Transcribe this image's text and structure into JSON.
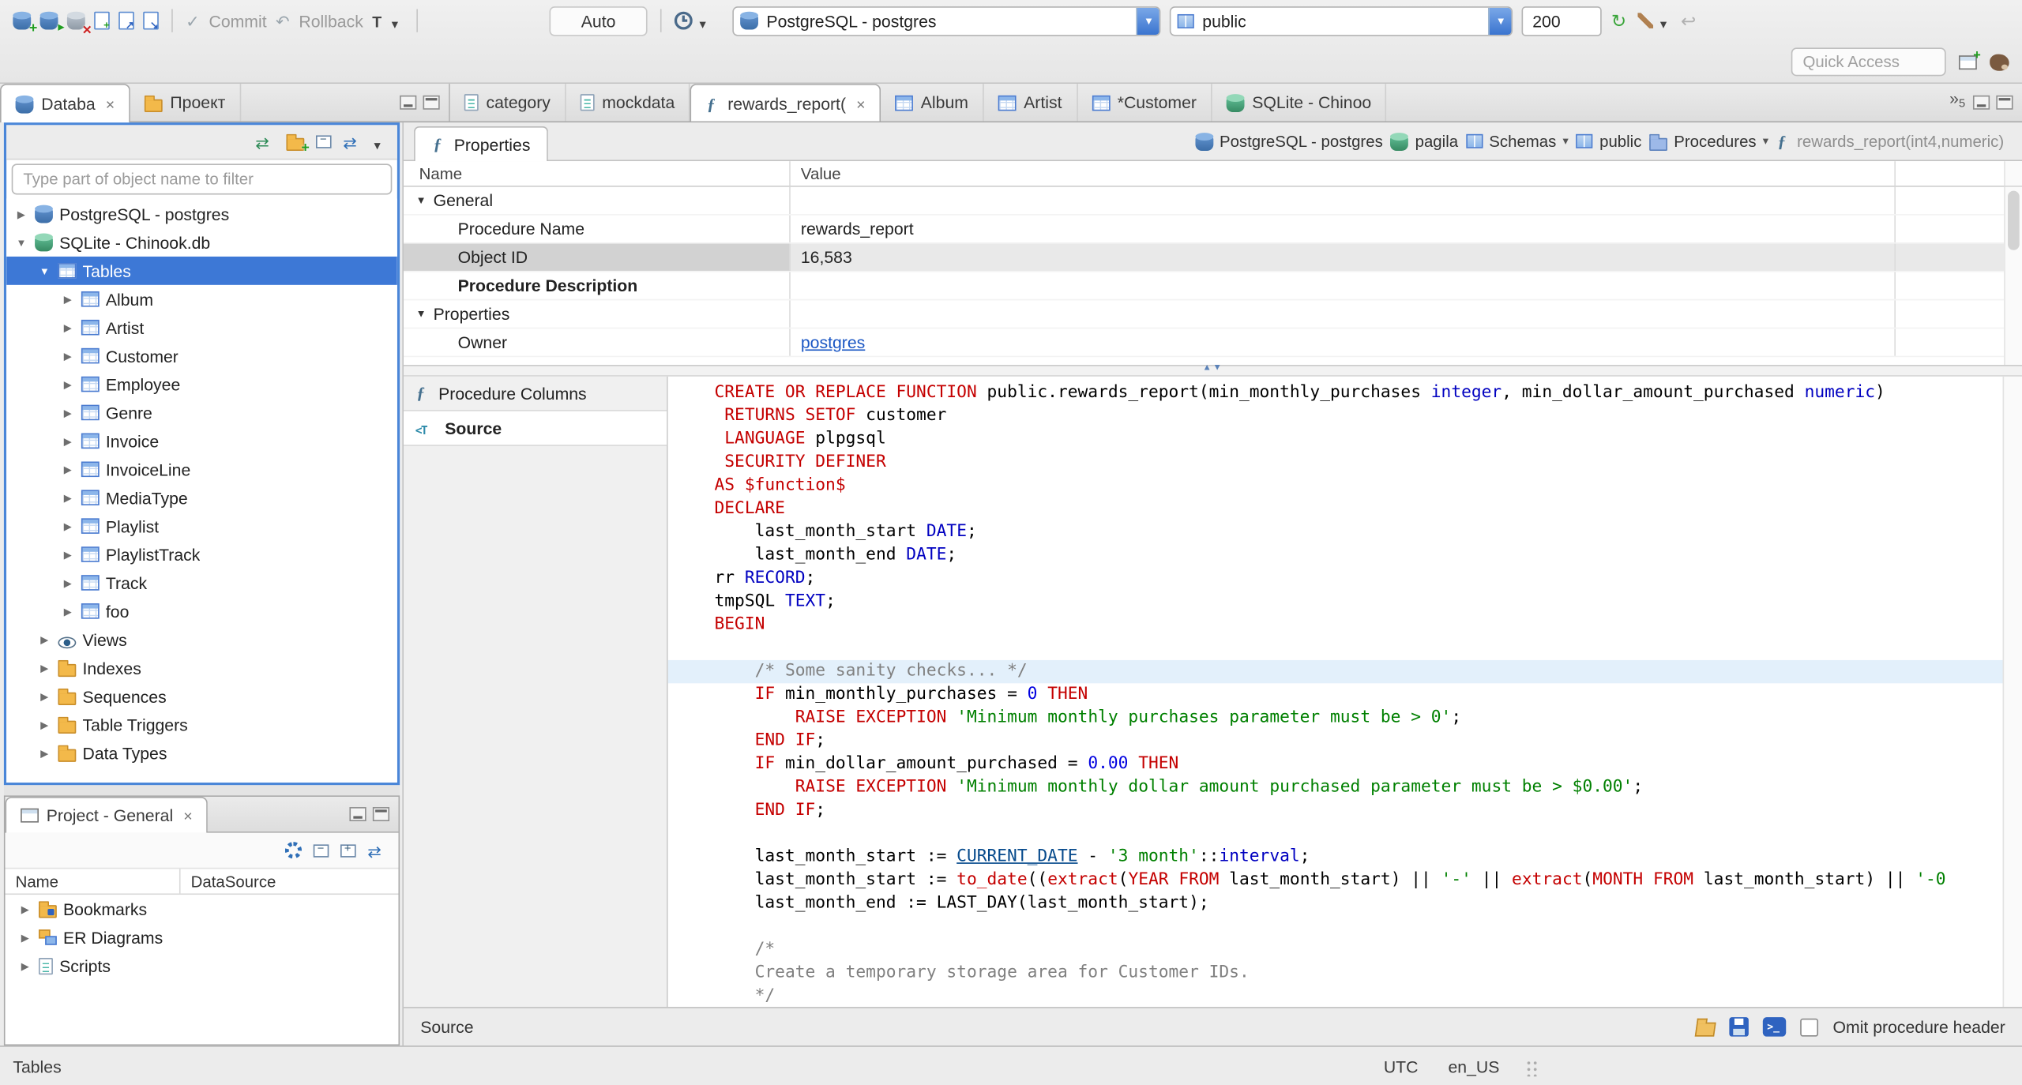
{
  "toolbar": {
    "commit": "Commit",
    "rollback": "Rollback",
    "transaction_mode": "T",
    "auto": "Auto",
    "connection": "PostgreSQL - postgres",
    "schema": "public",
    "fetch_size": "200",
    "quick_access": "Quick Access"
  },
  "left_tab_folder": {
    "tabs": [
      {
        "label": "Databa",
        "icon": "database-navigator",
        "active": true,
        "closable": true
      },
      {
        "label": "Проект",
        "icon": "projects"
      }
    ]
  },
  "editor_tab_folder": {
    "tabs": [
      {
        "label": "category",
        "icon": "sql-script"
      },
      {
        "label": "mockdata",
        "icon": "sql-script"
      },
      {
        "label": "rewards_report(",
        "icon": "function",
        "active": true,
        "closable": true
      },
      {
        "label": "Album",
        "icon": "table"
      },
      {
        "label": "Artist",
        "icon": "table"
      },
      {
        "label": "*Customer",
        "icon": "table"
      },
      {
        "label": "SQLite - Chinoo",
        "icon": "database"
      }
    ],
    "overflow_count": "5"
  },
  "navigator": {
    "filter_placeholder": "Type part of object name to filter",
    "tree": [
      {
        "label": "PostgreSQL - postgres",
        "icon": "postgres",
        "depth": 0,
        "expanded": false
      },
      {
        "label": "SQLite - Chinook.db",
        "icon": "sqlite",
        "depth": 0,
        "expanded": true
      },
      {
        "label": "Tables",
        "icon": "tables",
        "depth": 1,
        "expanded": true,
        "selected": true
      },
      {
        "label": "Album",
        "icon": "table",
        "depth": 2,
        "expanded": false
      },
      {
        "label": "Artist",
        "icon": "table",
        "depth": 2,
        "expanded": false
      },
      {
        "label": "Customer",
        "icon": "table",
        "depth": 2,
        "expanded": false
      },
      {
        "label": "Employee",
        "icon": "table",
        "depth": 2,
        "expanded": false
      },
      {
        "label": "Genre",
        "icon": "table",
        "depth": 2,
        "expanded": false
      },
      {
        "label": "Invoice",
        "icon": "table",
        "depth": 2,
        "expanded": false
      },
      {
        "label": "InvoiceLine",
        "icon": "table",
        "depth": 2,
        "expanded": false
      },
      {
        "label": "MediaType",
        "icon": "table",
        "depth": 2,
        "expanded": false
      },
      {
        "label": "Playlist",
        "icon": "table",
        "depth": 2,
        "expanded": false
      },
      {
        "label": "PlaylistTrack",
        "icon": "table",
        "depth": 2,
        "expanded": false
      },
      {
        "label": "Track",
        "icon": "table",
        "depth": 2,
        "expanded": false
      },
      {
        "label": "foo",
        "icon": "table",
        "depth": 2,
        "expanded": false
      },
      {
        "label": "Views",
        "icon": "views",
        "depth": 1,
        "expanded": false
      },
      {
        "label": "Indexes",
        "icon": "folder",
        "depth": 1,
        "expanded": false
      },
      {
        "label": "Sequences",
        "icon": "folder",
        "depth": 1,
        "expanded": false
      },
      {
        "label": "Table Triggers",
        "icon": "folder",
        "depth": 1,
        "expanded": false
      },
      {
        "label": "Data Types",
        "icon": "folder",
        "depth": 1,
        "expanded": false
      }
    ]
  },
  "project_panel": {
    "tab_label": "Project - General",
    "columns": [
      "Name",
      "DataSource"
    ],
    "rows": [
      {
        "label": "Bookmarks",
        "icon": "bookmarks"
      },
      {
        "label": "ER Diagrams",
        "icon": "er-diagram"
      },
      {
        "label": "Scripts",
        "icon": "scripts"
      }
    ]
  },
  "properties_view": {
    "tab_label": "Properties",
    "breadcrumb": [
      {
        "label": "PostgreSQL - postgres",
        "icon": "postgres"
      },
      {
        "label": "pagila",
        "icon": "database"
      },
      {
        "label": "Schemas",
        "icon": "schemas",
        "dropdown": true
      },
      {
        "label": "public",
        "icon": "schema"
      },
      {
        "label": "Procedures",
        "icon": "procedures",
        "dropdown": true
      },
      {
        "label": "rewards_report(int4,numeric)",
        "icon": "function",
        "muted": true
      }
    ],
    "columns": [
      "Name",
      "Value"
    ],
    "rows": [
      {
        "name": "General",
        "group": true,
        "expanded": true
      },
      {
        "name": "Procedure Name",
        "value": "rewards_report"
      },
      {
        "name": "Object ID",
        "value": "16,583",
        "selected": true
      },
      {
        "name": "Procedure Description",
        "bold": true
      },
      {
        "name": "Properties",
        "group": true,
        "expanded": true
      },
      {
        "name": "Owner",
        "value": "postgres",
        "link": true
      }
    ]
  },
  "source_view": {
    "side_tabs": [
      {
        "label": "Procedure Columns",
        "icon": "function"
      },
      {
        "label": "Source",
        "icon": "source",
        "active": true
      }
    ],
    "status_label": "Source",
    "omit_header_label": "Omit procedure header",
    "lines": [
      {
        "tokens": [
          [
            "k",
            "CREATE OR REPLACE FUNCTION "
          ],
          [
            "p",
            "public.rewards_report(min_monthly_purchases "
          ],
          [
            "t",
            "integer"
          ],
          [
            "p",
            ", min_dollar_amount_purchased "
          ],
          [
            "t",
            "numeric"
          ],
          [
            "p",
            ")"
          ]
        ]
      },
      {
        "tokens": [
          [
            "p",
            " "
          ],
          [
            "k",
            "RETURNS SETOF"
          ],
          [
            "p",
            " customer"
          ]
        ]
      },
      {
        "tokens": [
          [
            "p",
            " "
          ],
          [
            "k",
            "LANGUAGE"
          ],
          [
            "p",
            " plpgsql"
          ]
        ]
      },
      {
        "tokens": [
          [
            "p",
            " "
          ],
          [
            "k",
            "SECURITY DEFINER"
          ]
        ]
      },
      {
        "tokens": [
          [
            "k",
            "AS"
          ],
          [
            "p",
            " "
          ],
          [
            "k",
            "$function$"
          ]
        ]
      },
      {
        "tokens": [
          [
            "k",
            "DECLARE"
          ]
        ]
      },
      {
        "tokens": [
          [
            "p",
            "    last_month_start "
          ],
          [
            "t",
            "DATE"
          ],
          [
            "p",
            ";"
          ]
        ]
      },
      {
        "tokens": [
          [
            "p",
            "    last_month_end "
          ],
          [
            "t",
            "DATE"
          ],
          [
            "p",
            ";"
          ]
        ]
      },
      {
        "tokens": [
          [
            "p",
            "rr "
          ],
          [
            "t",
            "RECORD"
          ],
          [
            "p",
            ";"
          ]
        ]
      },
      {
        "tokens": [
          [
            "p",
            "tmpSQL "
          ],
          [
            "t",
            "TEXT"
          ],
          [
            "p",
            ";"
          ]
        ]
      },
      {
        "tokens": [
          [
            "k",
            "BEGIN"
          ]
        ]
      },
      {
        "tokens": []
      },
      {
        "hl": true,
        "tokens": [
          [
            "p",
            "    "
          ],
          [
            "c",
            "/* Some sanity checks... */"
          ]
        ]
      },
      {
        "tokens": [
          [
            "p",
            "    "
          ],
          [
            "k",
            "IF"
          ],
          [
            "p",
            " min_monthly_purchases = "
          ],
          [
            "n",
            "0"
          ],
          [
            "p",
            " "
          ],
          [
            "k",
            "THEN"
          ]
        ]
      },
      {
        "tokens": [
          [
            "p",
            "        "
          ],
          [
            "k",
            "RAISE EXCEPTION"
          ],
          [
            "p",
            " "
          ],
          [
            "s",
            "'Minimum monthly purchases parameter must be > 0'"
          ],
          [
            "p",
            ";"
          ]
        ]
      },
      {
        "tokens": [
          [
            "p",
            "    "
          ],
          [
            "k",
            "END IF"
          ],
          [
            "p",
            ";"
          ]
        ]
      },
      {
        "tokens": [
          [
            "p",
            "    "
          ],
          [
            "k",
            "IF"
          ],
          [
            "p",
            " min_dollar_amount_purchased = "
          ],
          [
            "n",
            "0.00"
          ],
          [
            "p",
            " "
          ],
          [
            "k",
            "THEN"
          ]
        ]
      },
      {
        "tokens": [
          [
            "p",
            "        "
          ],
          [
            "k",
            "RAISE EXCEPTION"
          ],
          [
            "p",
            " "
          ],
          [
            "s",
            "'Minimum monthly dollar amount purchased parameter must be > $0.00'"
          ],
          [
            "p",
            ";"
          ]
        ]
      },
      {
        "tokens": [
          [
            "p",
            "    "
          ],
          [
            "k",
            "END IF"
          ],
          [
            "p",
            ";"
          ]
        ]
      },
      {
        "tokens": []
      },
      {
        "tokens": [
          [
            "p",
            "    last_month_start := "
          ],
          [
            "d",
            "CURRENT_DATE"
          ],
          [
            "p",
            " - "
          ],
          [
            "s",
            "'3 month'"
          ],
          [
            "p",
            "::"
          ],
          [
            "t",
            "interval"
          ],
          [
            "p",
            ";"
          ]
        ]
      },
      {
        "tokens": [
          [
            "p",
            "    last_month_start := "
          ],
          [
            "k",
            "to_date"
          ],
          [
            "p",
            "(("
          ],
          [
            "k",
            "extract"
          ],
          [
            "p",
            "("
          ],
          [
            "k",
            "YEAR FROM"
          ],
          [
            "p",
            " last_month_start) || "
          ],
          [
            "s",
            "'-'"
          ],
          [
            "p",
            " || "
          ],
          [
            "k",
            "extract"
          ],
          [
            "p",
            "("
          ],
          [
            "k",
            "MONTH FROM"
          ],
          [
            "p",
            " last_month_start) || "
          ],
          [
            "s",
            "'-0"
          ]
        ]
      },
      {
        "tokens": [
          [
            "p",
            "    last_month_end := LAST_DAY(last_month_start);"
          ]
        ]
      },
      {
        "tokens": []
      },
      {
        "tokens": [
          [
            "p",
            "    "
          ],
          [
            "c",
            "/*"
          ]
        ]
      },
      {
        "tokens": [
          [
            "p",
            "    "
          ],
          [
            "c",
            "Create a temporary storage area for Customer IDs."
          ]
        ]
      },
      {
        "tokens": [
          [
            "p",
            "    "
          ],
          [
            "c",
            "*/"
          ]
        ]
      }
    ]
  },
  "status_bar": {
    "left": "Tables",
    "timezone": "UTC",
    "locale": "en_US"
  }
}
